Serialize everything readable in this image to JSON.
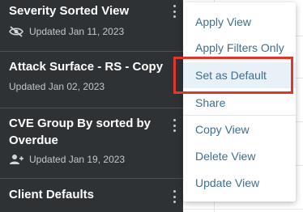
{
  "views": [
    {
      "title": "Severity Sorted View",
      "updated": "Updated Jan 11, 2023",
      "icon": "eye-off-icon"
    },
    {
      "title": "Attack Surface - RS - Copy",
      "updated": "Updated Jan 02, 2023",
      "icon": "none"
    },
    {
      "title": "CVE Group By sorted by Overdue",
      "updated": "Updated Jan 19, 2023",
      "icon": "person-add-icon"
    },
    {
      "title": "Client Defaults",
      "updated": "",
      "icon": "none"
    }
  ],
  "menu": {
    "items": [
      {
        "label": "Apply View"
      },
      {
        "label": "Apply Filters Only"
      },
      {
        "label": "Set as Default",
        "highlighted": true
      },
      {
        "label": "Share"
      },
      {
        "label": "Copy View"
      },
      {
        "label": "Delete View"
      },
      {
        "label": "Update View"
      }
    ]
  },
  "colors": {
    "list_background": "#2f3235",
    "menu_text": "#3e6e8e",
    "highlight": "#e8f1f8",
    "annotation_border": "#e0372b"
  }
}
